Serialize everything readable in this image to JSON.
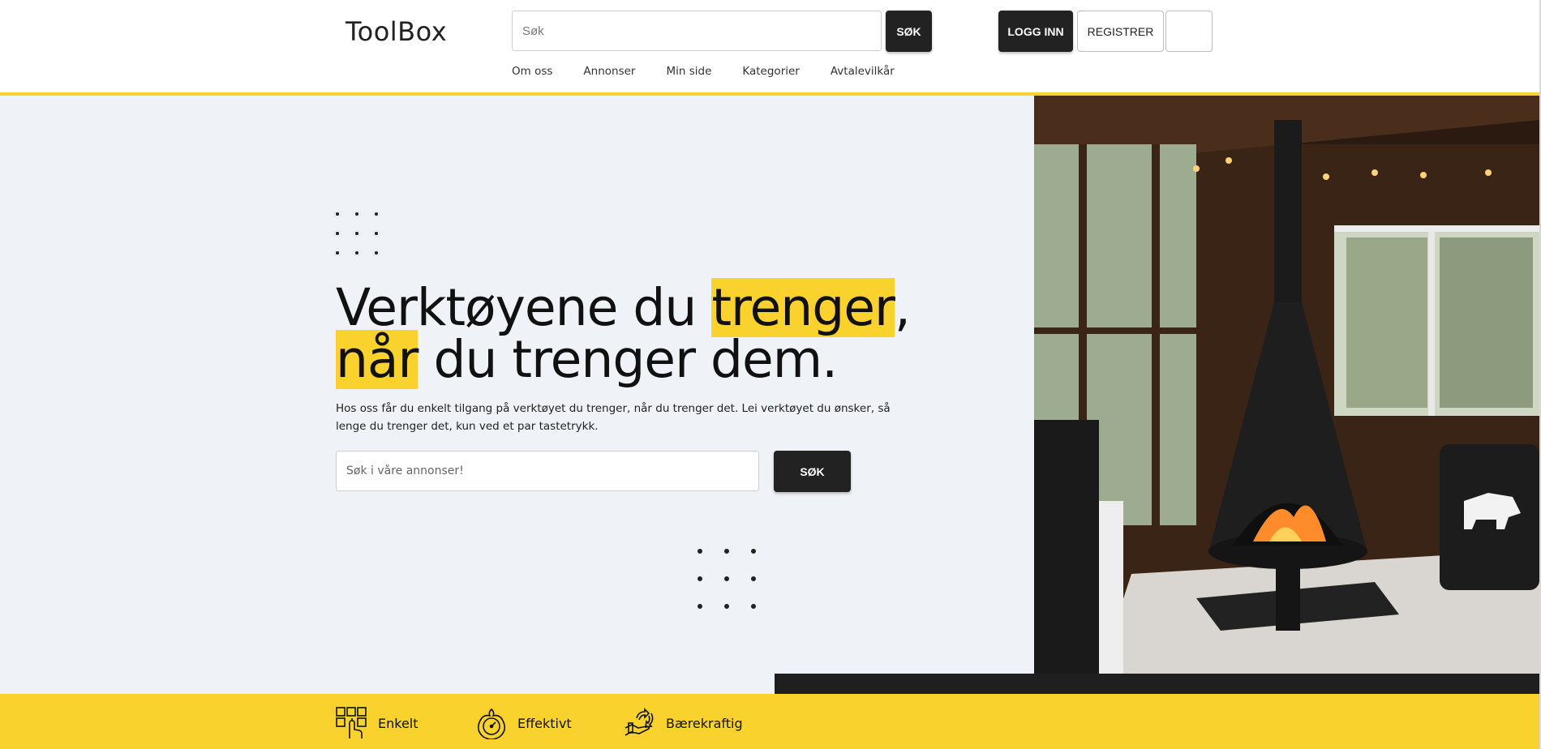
{
  "header": {
    "logo": "ToolBox",
    "search_placeholder": "Søk",
    "search_button": "SØK",
    "login_button": "LOGG INN",
    "register_button": "REGISTRER",
    "nav": [
      {
        "label": "Om oss"
      },
      {
        "label": "Annonser"
      },
      {
        "label": "Min side"
      },
      {
        "label": "Kategorier"
      },
      {
        "label": "Avtalevilkår"
      }
    ]
  },
  "hero": {
    "headline": {
      "part1": "Verktøyene du ",
      "highlight1": "trenger",
      "part2": ",",
      "highlight2": "når",
      "part3": " du trenger dem."
    },
    "intro": "Hos oss får du enkelt tilgang på verktøyet du trenger, når du trenger det. Lei verktøyet du ønsker, så lenge du trenger det, kun ved et par tastetrykk.",
    "search_placeholder": "Søk i våre annonser!",
    "search_button": "SØK"
  },
  "features": [
    {
      "label": "Enkelt",
      "icon": "keyboard-hand-icon"
    },
    {
      "label": "Effektivt",
      "icon": "stopwatch-icon"
    },
    {
      "label": "Bærekraftig",
      "icon": "hand-recycle-icon"
    }
  ],
  "colors": {
    "accent": "#f9d22d",
    "dark": "#222222",
    "hero_bg": "#eff2f7"
  }
}
